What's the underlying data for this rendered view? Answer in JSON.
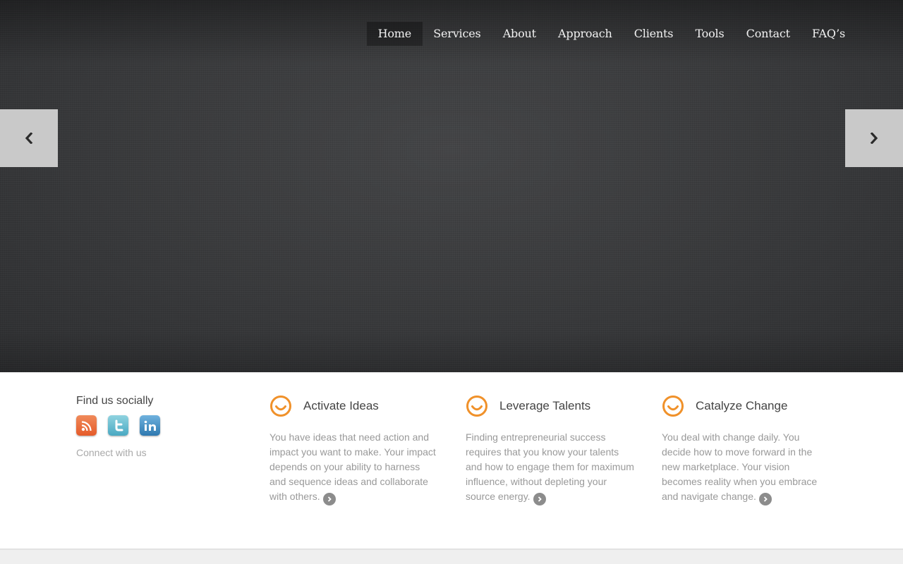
{
  "nav": {
    "items": [
      {
        "label": "Home"
      },
      {
        "label": "Services"
      },
      {
        "label": "About"
      },
      {
        "label": "Approach"
      },
      {
        "label": "Clients"
      },
      {
        "label": "Tools"
      },
      {
        "label": "Contact"
      },
      {
        "label": "FAQ’s"
      }
    ],
    "active": "Home"
  },
  "slider": {
    "prev_icon": "chevron-left-icon",
    "next_icon": "chevron-right-icon"
  },
  "social": {
    "title": "Find us socially",
    "icons": [
      "rss-icon",
      "twitter-icon",
      "linkedin-icon"
    ],
    "subtitle": "Connect with us"
  },
  "features": [
    {
      "title": "Activate Ideas",
      "text": "You have ideas that need action and impact you want to make. Your impact depends on your ability to harness and sequence ideas and collaborate with others."
    },
    {
      "title": "Leverage Talents",
      "text": "Finding entrepreneurial success requires that you know your talents and how to engage them for maximum influence, without depleting your source energy."
    },
    {
      "title": "Catalyze Change",
      "text": "You deal with change daily. You decide how to move forward in the new marketplace. Your vision becomes reality when you embrace and navigate change."
    }
  ],
  "colors": {
    "accent": "#f0912a",
    "hero_bg": "#38393b",
    "arrow_bg": "#c9c9c9"
  }
}
